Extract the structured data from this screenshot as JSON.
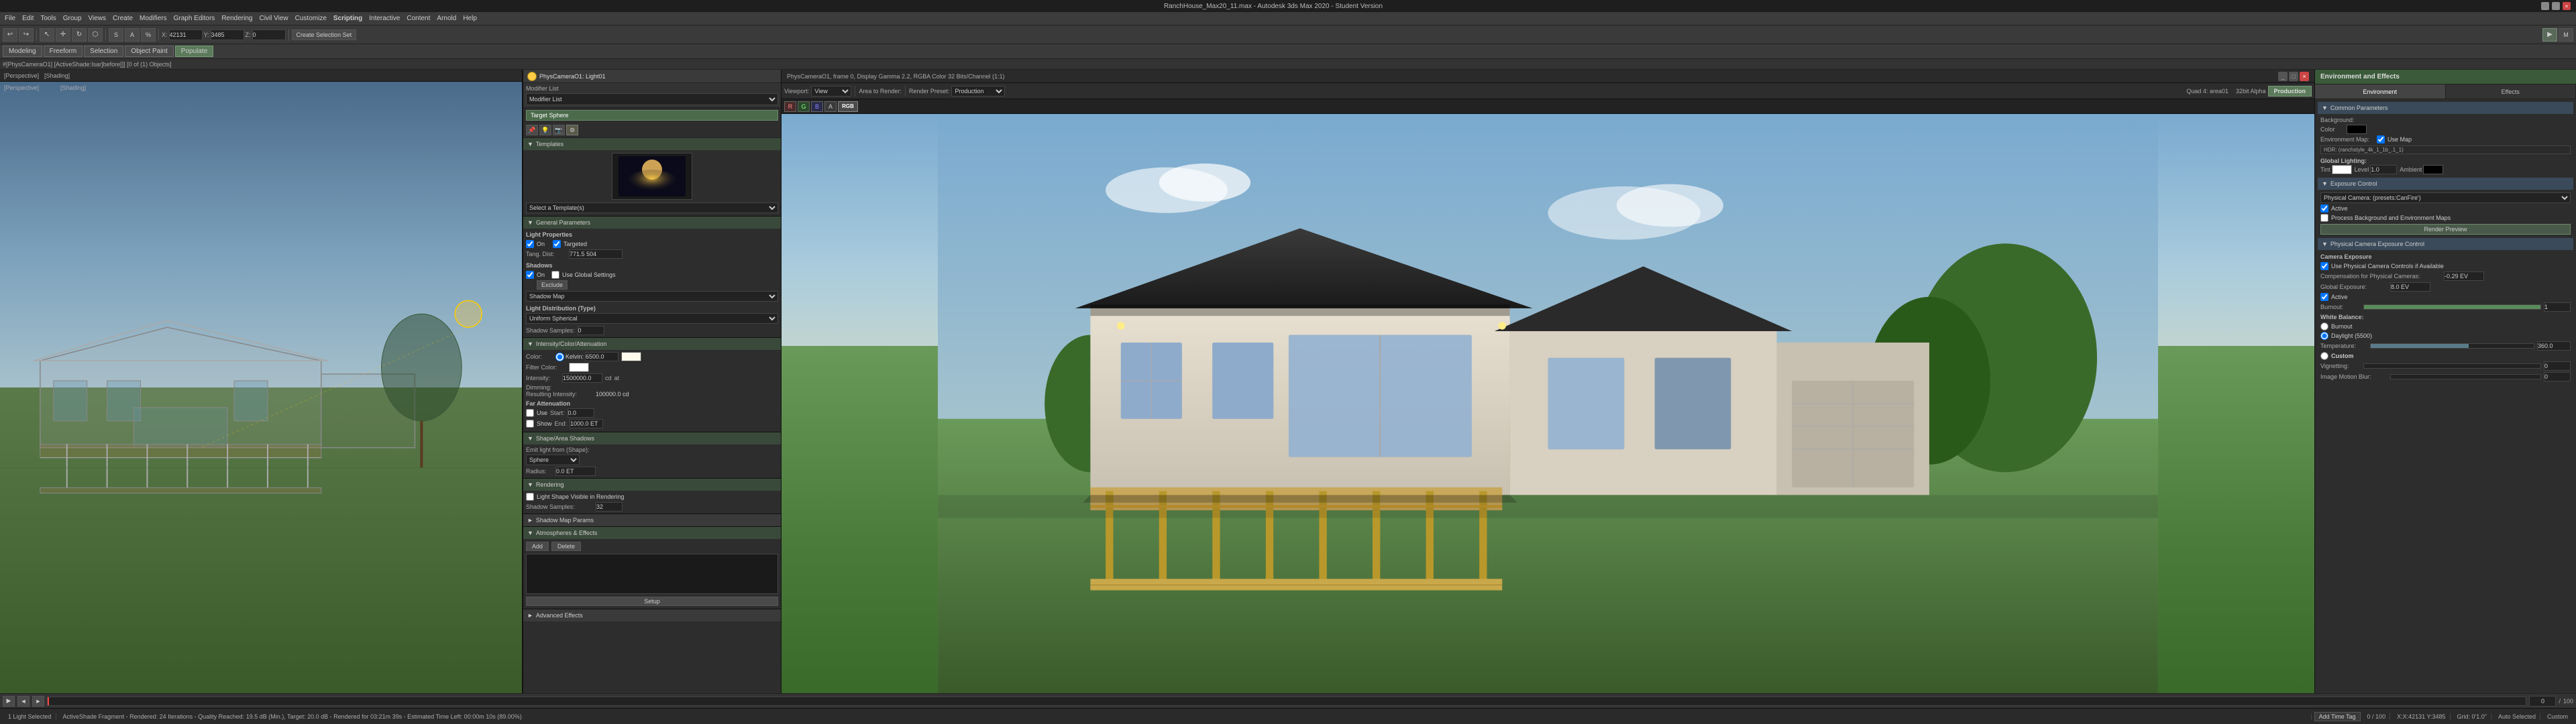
{
  "app": {
    "title": "RanchHouse_Max20_11.max - Autodesk 3ds Max 2020 - Student Version",
    "window_controls": [
      "minimize",
      "maximize",
      "close"
    ]
  },
  "menu": {
    "items": [
      "File",
      "Edit",
      "Tools",
      "Group",
      "Views",
      "Create",
      "Modifiers",
      "Graph Editors",
      "Rendering",
      "Civil View",
      "Customize",
      "Scripting",
      "Interactive",
      "Content",
      "Arnold",
      "Help"
    ]
  },
  "toolbar": {
    "items": [
      "undo",
      "redo",
      "select",
      "move",
      "rotate",
      "scale",
      "reference",
      "snap",
      "mirror",
      "align",
      "material",
      "render",
      "render-settings"
    ]
  },
  "toolbar2": {
    "items": [
      "Modeling",
      "Freeform",
      "Selection",
      "Object Paint",
      "Populate"
    ]
  },
  "path": "#[PhysCameraO1] [ActiveShade:Isar]before[]] [0 of (1) Objects]",
  "viewport": {
    "label": "Perspective",
    "mode": "Wireframe"
  },
  "light_panel": {
    "title": "PhysCameraO1: Light01",
    "modifier_list_label": "Modifier List",
    "selected_item": "Target Sphere",
    "tabs": [
      "tab1",
      "tab2",
      "tab3",
      "tab4"
    ],
    "templates_label": "Templates",
    "templates_dropdown": "Select a Template(s)",
    "general_params": {
      "title": "General Parameters",
      "light_properties": "Light Properties",
      "on": "On",
      "targeted": "Targeted",
      "tang_dist": "Tang. Dist:",
      "tang_val": "771.5 504",
      "shadows": "Shadows",
      "on_shadow": "On",
      "use_global": "Use Global Settings",
      "exclude_btn": "Exclude",
      "shadow_map": "Shadow Map",
      "light_dist_type": "Light Distribution (Type)",
      "uniform_spherical": "Uniform Spherical",
      "shadow_samples": "Shadow Samples:",
      "shadow_samples_val": "0"
    },
    "intensity": {
      "title": "Intensity/Color/Attenuation",
      "color_label": "Color:",
      "kelvin_label": "Kelvin:",
      "kelvin_val": "6500.0",
      "filter_color": "Filter Color:",
      "intensity_label": "Intensity:",
      "cd": "cd",
      "at": "at",
      "cd_val": "1500000.0",
      "dimming_label": "Dimming:",
      "resulting_intensity": "Resulting Intensity:",
      "resulting_val": "100000.0 cd",
      "far_attenuation_label": "Far Attenuation",
      "use_label": "Use",
      "start_label": "Start:",
      "end_label": "End:",
      "far_start": "0.0",
      "far_end": "1000.0 ET",
      "show_label": "Show"
    },
    "shape_area": {
      "title": "Shape/Area Shadows",
      "emit_light_from": "Emit light from (Shape):",
      "sphere_label": "Sphere",
      "radius_label": "Radius:",
      "radius_val": "0.0 ET"
    },
    "rendering": {
      "title": "Rendering",
      "light_shape_visible": "Light Shape Visible in Rendering",
      "shadow_samples": "Shadow Samples:",
      "shadow_samples_val": "32"
    },
    "shadow_map_params": {
      "title": "Shadow Map Params"
    },
    "atmos_effects": {
      "title": "Atmospheres & Effects",
      "add_btn": "Add",
      "delete_btn": "Delete",
      "setup_btn": "Setup"
    },
    "advanced": {
      "title": "Advanced Effects"
    }
  },
  "render_window": {
    "title": "PhysCameraO1, frame 0, Display Gamma 2.2, RGBA Color 32 Bits/Channel (1:1)",
    "viewport_label": "Viewport:",
    "viewport_val": "View",
    "area_render_label": "Area to Render:",
    "render_preset_label": "Render Preset:",
    "render_btn": "Production",
    "display_label": "Quad 4: area01",
    "alpha_label": "32bit Alpha"
  },
  "env_effects": {
    "title": "Environment and Effects",
    "tabs": [
      "Environment",
      "Effects"
    ],
    "common_params": {
      "title": "Common Parameters",
      "background_label": "Background:",
      "color_label": "Color",
      "env_map": "Environment Map:",
      "use_map": "Use Map",
      "map_name": "HDR: (ranchstyle_4k_1_1b_.1_1)",
      "global_lighting": "Global Lighting:",
      "tint_label": "Tint",
      "level_label": "Level",
      "ambient_label": "Ambient"
    },
    "exposure_control": {
      "title": "Exposure Control",
      "physical_camera": "Physical Camera: (presets:CanFire')",
      "active_label": "Active",
      "burnout_label": "Burnout:",
      "burnout_val": "1",
      "process_bg": "Process Background and Environment Maps",
      "render_preview_btn": "Render Preview"
    },
    "phys_camera_exposure": {
      "title": "Physical Camera Exposure Control",
      "camera_exposure": "Camera Exposure",
      "use_physical": "Use Physical Camera Controls if Available",
      "compensation": "Compensation for Physical Cameras:",
      "comp_val": "-0.29 EV",
      "global_exposure": "Global Exposure:",
      "exp_val": "8.0 EV",
      "active_label": "Active",
      "burnout_label": "Burnout:",
      "burnout_val": "1",
      "white_balance": "White Balance:",
      "illuminant": "Burnout",
      "daylight": "Daylight (5500)",
      "temperature": "Temperature:",
      "temp_val": "360.0",
      "custom_label": "Custom",
      "vignetting": "Vignetting:",
      "image_motion": "Image Motion Blur:"
    }
  },
  "status": {
    "light_selected": "1 Light Selected",
    "render_info": "ActiveShade Fragment - Rendered: 24 Iterations - Quality Reached: 19.5 dB (Min.), Target: 20.0 dB - Rendered for 03:21m 39s - Estimated Time Left: 00:00m 10s (89.00%)",
    "frame": "0 / 100",
    "grid": "Grid: 0'1.0\"",
    "coordinates": "X:42131 Y:3485",
    "addons": "Add Time Tag",
    "custom": "Custom",
    "auto_selected": "Auto Selected"
  },
  "timeline": {
    "current_frame": "0",
    "total_frames": "100"
  }
}
